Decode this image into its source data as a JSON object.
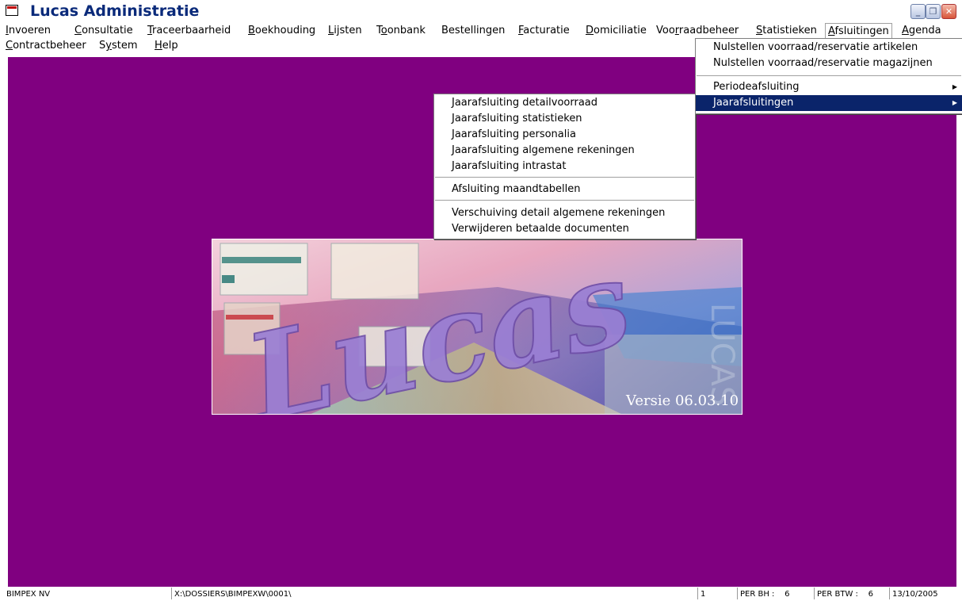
{
  "window": {
    "title": "Lucas Administratie"
  },
  "menubar": {
    "row1": [
      {
        "label": "Invoeren",
        "u": "I"
      },
      {
        "label": "Consultatie",
        "u": "C"
      },
      {
        "label": "Traceerbaarheid",
        "u": "T"
      },
      {
        "label": "Boekhouding",
        "u": "B"
      },
      {
        "label": "Lijsten",
        "u": "L"
      },
      {
        "label": "Toonbank",
        "u": "o"
      },
      {
        "label": "Bestellingen",
        "u": ""
      },
      {
        "label": "Facturatie",
        "u": "F"
      },
      {
        "label": "Domiciliatie",
        "u": "D"
      },
      {
        "label": "Voorraadbeheer",
        "u": "r"
      },
      {
        "label": "Statistieken",
        "u": "S"
      },
      {
        "label": "Afsluitingen",
        "u": "A"
      },
      {
        "label": "Agenda",
        "u": "A"
      }
    ],
    "row2": [
      {
        "label": "Contractbeheer",
        "u": "C"
      },
      {
        "label": "System",
        "u": "y"
      },
      {
        "label": "Help",
        "u": "H"
      }
    ]
  },
  "afsluitingen_menu": {
    "items": [
      "Nulstellen voorraad/reservatie artikelen",
      "Nulstellen voorraad/reservatie magazijnen",
      "Periodeafsluiting",
      "Jaarafsluitingen"
    ]
  },
  "jaar_menu": {
    "items": [
      "Jaarafsluiting detailvoorraad",
      "Jaarafsluiting statistieken",
      "Jaarafsluiting personalia",
      "Jaarafsluiting algemene rekeningen",
      "Jaarafsluiting intrastat",
      "Afsluiting maandtabellen",
      "Verschuiving detail algemene rekeningen",
      "Verwijderen betaalde documenten"
    ]
  },
  "splash": {
    "logo_text": "Lucas",
    "version": "Versie 06.03.10"
  },
  "statusbar": {
    "company": "BIMPEX NV",
    "path": "X:\\DOSSIERS\\BIMPEXW\\0001\\",
    "field1": "1",
    "per_bh": "PER BH :    6",
    "per_btw": "PER BTW :    6",
    "date": "13/10/2005"
  },
  "colors": {
    "workspace": "#800080",
    "menu_highlight": "#0a246a"
  },
  "icons": [
    "app-icon",
    "minimize-icon",
    "restore-icon",
    "close-icon",
    "submenu-arrow-icon"
  ]
}
